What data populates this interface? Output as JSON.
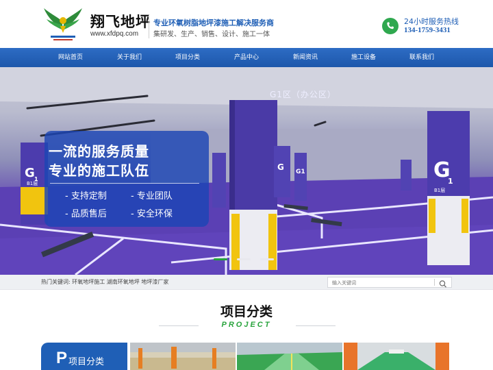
{
  "header": {
    "logo_name": "翔飞地坪",
    "logo_url": "www.xfdpq.com",
    "slogan_main": "专业环氧树脂地坪漆施工解决服务商",
    "slogan_sub": "集研发、生产、销售、设计、施工一体",
    "hotline_label": "24小时服务热线",
    "hotline_number": "134-1759-3431"
  },
  "nav": {
    "items": [
      {
        "label": "网站首页"
      },
      {
        "label": "关于我们"
      },
      {
        "label": "项目分类"
      },
      {
        "label": "产品中心"
      },
      {
        "label": "新闻资讯"
      },
      {
        "label": "施工设备"
      },
      {
        "label": "联系我们"
      }
    ]
  },
  "banner": {
    "zone_label": "G1区（办公区）",
    "pillar_labels": [
      {
        "big": "G",
        "small": "1",
        "floor": "B1层"
      }
    ],
    "pillar_small_label": "B1层",
    "promo_line1": "一流的服务质量",
    "promo_line2": "专业的施工队伍",
    "features": [
      "- 支持定制",
      "- 专业团队",
      "- 品质售后",
      "- 安全环保"
    ],
    "slides": {
      "count": 3,
      "active": 1
    }
  },
  "keywords": {
    "label": "热门关键词:",
    "items": [
      "环氧地坪施工",
      "湖南环氧地坪",
      "地坪漆厂家"
    ]
  },
  "search": {
    "placeholder": "输入关键词"
  },
  "section": {
    "title": "项目分类",
    "subtitle": "PROJECT",
    "category_letter": "P",
    "category_label": "项目分类"
  },
  "colors": {
    "brand_blue": "#1f5fb6",
    "brand_green": "#27a33b",
    "floor_purple": "#5a3fb0",
    "phone_green": "#2fa84f"
  }
}
